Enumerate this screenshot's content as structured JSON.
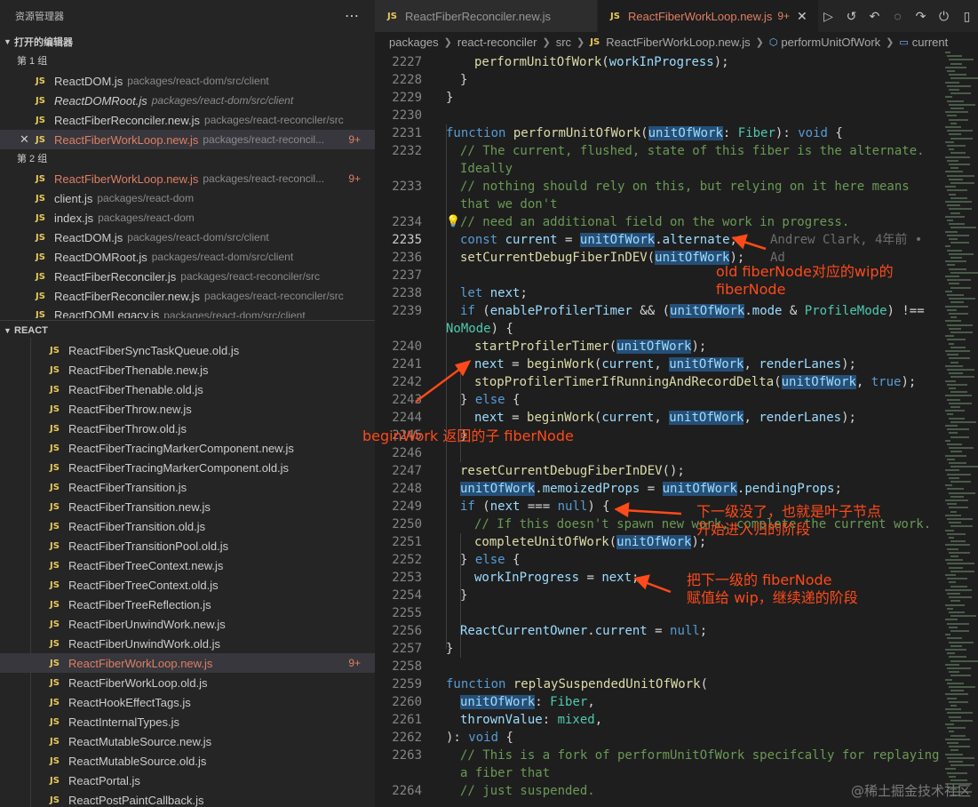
{
  "sidebar": {
    "title": "资源管理器",
    "more_icon": "⋯",
    "open_editors": {
      "header": "打开的编辑器",
      "groups": [
        {
          "label": "第 1 组",
          "files": [
            {
              "name": "ReactDOM.js",
              "path": "packages/react-dom/src/client"
            },
            {
              "name": "ReactDOMRoot.js",
              "path": "packages/react-dom/src/client"
            },
            {
              "name": "ReactFiberReconciler.new.js",
              "path": "packages/react-reconciler/src"
            },
            {
              "name": "ReactFiberWorkLoop.new.js",
              "path": "packages/react-reconcil...",
              "badge": "9+"
            }
          ]
        },
        {
          "label": "第 2 组",
          "files": [
            {
              "name": "ReactFiberWorkLoop.new.js",
              "path": "packages/react-reconcil...",
              "badge": "9+"
            },
            {
              "name": "client.js",
              "path": "packages/react-dom"
            },
            {
              "name": "index.js",
              "path": "packages/react-dom"
            },
            {
              "name": "ReactDOM.js",
              "path": "packages/react-dom/src/client"
            },
            {
              "name": "ReactDOMRoot.js",
              "path": "packages/react-dom/src/client"
            },
            {
              "name": "ReactFiberReconciler.js",
              "path": "packages/react-reconciler/src"
            },
            {
              "name": "ReactFiberReconciler.new.js",
              "path": "packages/react-reconciler/src"
            },
            {
              "name": "ReactDOMLegacy.js",
              "path": "packages/react-dom/src/client"
            }
          ]
        }
      ]
    },
    "project": {
      "header": "REACT",
      "files": [
        {
          "name": "ReactFiberSyncTaskQueue.old.js"
        },
        {
          "name": "ReactFiberThenable.new.js"
        },
        {
          "name": "ReactFiberThenable.old.js"
        },
        {
          "name": "ReactFiberThrow.new.js"
        },
        {
          "name": "ReactFiberThrow.old.js"
        },
        {
          "name": "ReactFiberTracingMarkerComponent.new.js"
        },
        {
          "name": "ReactFiberTracingMarkerComponent.old.js"
        },
        {
          "name": "ReactFiberTransition.js"
        },
        {
          "name": "ReactFiberTransition.new.js"
        },
        {
          "name": "ReactFiberTransition.old.js"
        },
        {
          "name": "ReactFiberTransitionPool.old.js"
        },
        {
          "name": "ReactFiberTreeContext.new.js"
        },
        {
          "name": "ReactFiberTreeContext.old.js"
        },
        {
          "name": "ReactFiberTreeReflection.js"
        },
        {
          "name": "ReactFiberUnwindWork.new.js"
        },
        {
          "name": "ReactFiberUnwindWork.old.js"
        },
        {
          "name": "ReactFiberWorkLoop.new.js",
          "badge": "9+"
        },
        {
          "name": "ReactFiberWorkLoop.old.js"
        },
        {
          "name": "ReactHookEffectTags.js"
        },
        {
          "name": "ReactInternalTypes.js"
        },
        {
          "name": "ReactMutableSource.new.js"
        },
        {
          "name": "ReactMutableSource.old.js"
        },
        {
          "name": "ReactPortal.js"
        },
        {
          "name": "ReactPostPaintCallback.js"
        }
      ]
    }
  },
  "js_label": "JS",
  "tabs": [
    {
      "label": "ReactFiberReconciler.new.js"
    },
    {
      "label": "ReactFiberWorkLoop.new.js",
      "badge": "9+",
      "close": "✕"
    }
  ],
  "tab_actions": [
    "▷",
    "↺",
    "↶",
    "◌",
    "↷",
    "⏻",
    "▯"
  ],
  "breadcrumb": [
    "packages",
    "react-reconciler",
    "src",
    "ReactFiberWorkLoop.new.js",
    "performUnitOfWork",
    "current"
  ],
  "code": {
    "line_numbers": [
      "2227",
      "2228",
      "2229",
      "2230",
      "2231",
      "2232",
      "2233",
      "2234",
      "2235",
      "2236",
      "2237",
      "2238",
      "2239",
      "2240",
      "2241",
      "2242",
      "2243",
      "2244",
      "2245",
      "2246",
      "2247",
      "2248",
      "2249",
      "2250",
      "2251",
      "2252",
      "2253",
      "2254",
      "2255",
      "2256",
      "2257",
      "2258",
      "2259",
      "2260",
      "2261",
      "2262",
      "2263",
      "2264"
    ],
    "blame": "Andrew Clark, 4年前 • Ad",
    "lines": [
      "performUnitOfWork(workInProgress);",
      "}",
      "}",
      "function performUnitOfWork(unitOfWork: Fiber): void {",
      "// The current, flushed, state of this fiber is the alternate.",
      "Ideally",
      "// nothing should rely on this, but relying on it here means",
      "that we don't",
      "// need an additional field on the work in progress.",
      "const current = unitOfWork.alternate;",
      "setCurrentDebugFiberInDEV(unitOfWork);",
      "let next;",
      "if (enableProfilerTimer && (unitOfWork.mode & ProfileMode) !==",
      "NoMode) {",
      "startProfilerTimer(unitOfWork);",
      "next = beginWork(current, unitOfWork, renderLanes);",
      "stopProfilerTimerIfRunningAndRecordDelta(unitOfWork, true);",
      "} else {",
      "next = beginWork(current, unitOfWork, renderLanes);",
      "}",
      "resetCurrentDebugFiberInDEV();",
      "unitOfWork.memoizedProps = unitOfWork.pendingProps;",
      "if (next === null) {",
      "// If this doesn't spawn new work, complete the current work.",
      "completeUnitOfWork(unitOfWork);",
      "} else {",
      "workInProgress = next;",
      "}",
      "ReactCurrentOwner.current = null;",
      "}",
      "function replaySuspendedUnitOfWork(",
      "unitOfWork: Fiber,",
      "thrownValue: mixed,",
      "): void {",
      "// This is a fork of performUnitOfWork specifcally for replaying",
      "a fiber that",
      "// just suspended."
    ]
  },
  "annotations": {
    "a1_line1": "old fiberNode对应的wip的",
    "a1_line2": "fiberNode",
    "a2": "beginWork 返回的子 fiberNode",
    "a3_line1": "下一级没了，也就是叶子节点",
    "a3_line2": "开始进入归的阶段",
    "a4_line1": "把下一级的 fiberNode",
    "a4_line2": "赋值给 wip，继续递的阶段",
    "color": "#ff4a1a"
  },
  "watermark": "@稀土掘金技术社区"
}
